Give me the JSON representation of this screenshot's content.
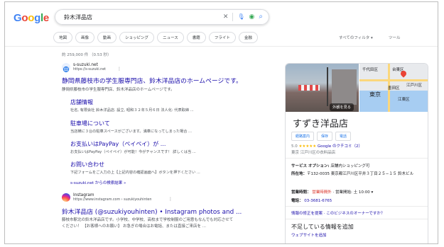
{
  "header": {
    "logo_letters": [
      {
        "ch": "G",
        "color": "#4285f4"
      },
      {
        "ch": "o",
        "color": "#ea4335"
      },
      {
        "ch": "o",
        "color": "#fbbc05"
      },
      {
        "ch": "g",
        "color": "#4285f4"
      },
      {
        "ch": "l",
        "color": "#34a853"
      },
      {
        "ch": "e",
        "color": "#ea4335"
      }
    ],
    "query": "鈴木洋品店",
    "clear_glyph": "✕",
    "mic_glyph": "🎙",
    "lens_glyph": "◉",
    "search_glyph": "⌕"
  },
  "tabs": [
    "地図",
    "画像",
    "動画",
    "ショッピング",
    "ニュース",
    "書籍",
    "フライト",
    "金融"
  ],
  "tools": {
    "filters": "すべてのフィルタ ▾",
    "tools": "ツール"
  },
  "stats": "約 259,000 件 （0.53 秒）",
  "result1": {
    "site_name": "s-suzuki.net",
    "url": "https://s-suzuki.net",
    "menu": "⋮",
    "title": "静岡県藤枝市の学生服専門店、鈴木洋品店のホームページです。",
    "snippet": "静岡県藤枝市の学生服専門店、鈴木洋品店のホームページです。",
    "sitelinks": [
      {
        "title": "店舗情報",
        "snippet": "社名, 有限会社 鈴木洋品店. 設立, 昭和３２年５月６日 法人化: 代表取締 ..."
      },
      {
        "title": "駐車場について",
        "snippet": "当店横に３台の駐車スペースがございます。満車になってしまった場合 ..."
      },
      {
        "title": "お支払いはPayPay（ペイペイ）が ...",
        "snippet": "お支払いはPayPay（ペイペイ）が可能！今がチャンスです！ 詳しくは当 ..."
      },
      {
        "title": "お問い合わせ",
        "snippet": "下記フォームをご入力の上【上記内容の確認画面へ】ボタンを押下ください ..."
      }
    ],
    "more": "s-suzuki.net からの検索結果 »"
  },
  "result2": {
    "site_name": "Instagram",
    "url": "https://www.instagram.com › suzukiyouhinten",
    "menu": "⋮",
    "title": "鈴木洋品店 (@suzukiyouhinten) • Instagram photos and ...",
    "snippet1": "藤枝市駅北の鈴木洋品店です。小学校、中学校、高校まで学校制服のご用意もなんでも対応させて",
    "snippet2": "ください！ 【お客様へのお願い】 お急ぎの場合はお電話、または直接ご来店を ..."
  },
  "knowledge_panel": {
    "outside_view": "外観を見る",
    "map_labels": {
      "c1": "千代田区",
      "c2": "台東区",
      "c3": "墨田区",
      "c4": "江戸川区",
      "c5": "江東区",
      "city": "東京"
    },
    "name": "すずき洋品店",
    "buttons": [
      "経路案内",
      "保存",
      "電話"
    ],
    "rating_value": "5.0",
    "stars": "★★★★★",
    "review_link": "Google のクチコミ（2）",
    "type": "東京 江戸川区の衣料品店",
    "service_label": "サービス オプション:",
    "service_value": "店舗内ショッピング可",
    "address_label": "所在地：",
    "address_value": "〒132-0035 東京都江戸川区平井３丁目２５−１５ 鈴木ビル",
    "hours_label": "営業時間：",
    "hours_status": "営業時間外",
    "hours_detail": "· 営業開始: 土 10:00 ▾",
    "phone_label": "電話：",
    "phone_value": "03-3681-6765",
    "suggest_link": "情報の修正を提案 · このビジネスのオーナーですか？",
    "missing_title": "不足している情報を追加",
    "add_website": "ウェブサイトを追加"
  }
}
